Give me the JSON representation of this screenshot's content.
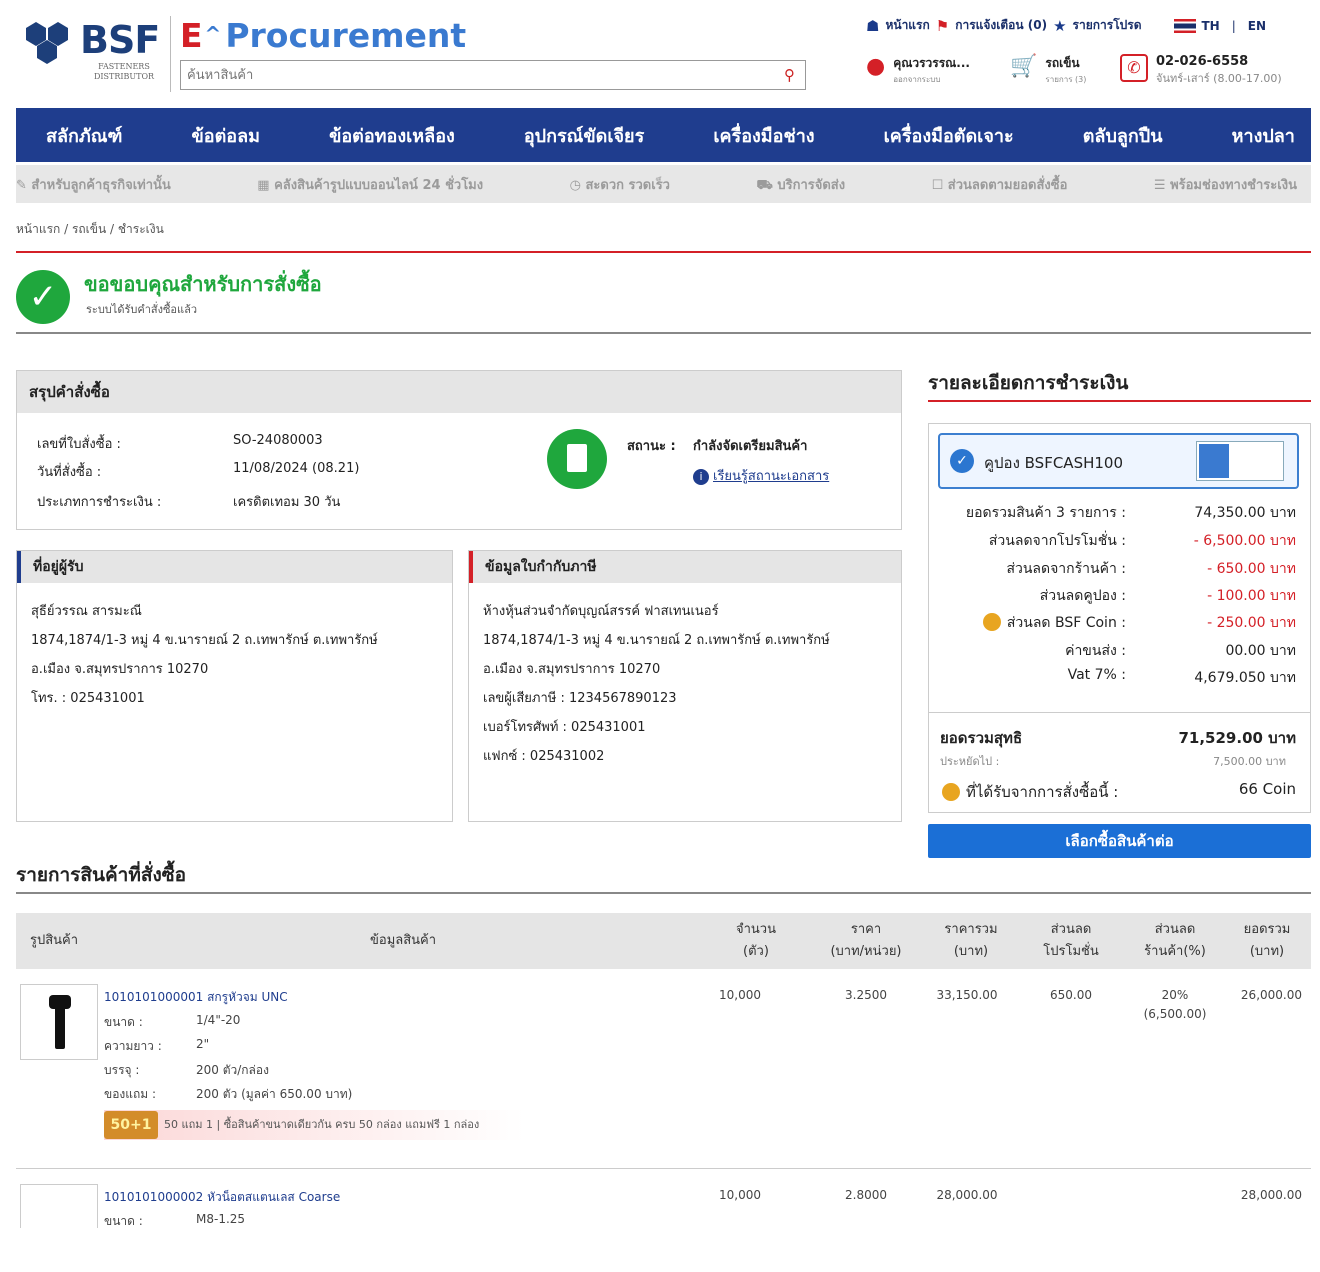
{
  "header": {
    "logo_text": "BSF",
    "logo_sub": "FASTENERS DISTRIBUTOR",
    "brand_e": "E",
    "brand_name": "Procurement",
    "search_placeholder": "ค้นหาสินค้า",
    "links": [
      "หน้าแรก",
      "การแจ้งเตือน (0)",
      "รายการโปรด"
    ],
    "lang_th": "TH",
    "lang_sep": "|",
    "lang_en": "EN",
    "user_name": "คุณวรวรรณ...",
    "user_sub": "ออกจากระบบ",
    "cart_label": "รถเข็น",
    "cart_sub": "รายการ (3)",
    "phone": "02-026-6558",
    "phone_hours": "จันทร์-เสาร์ (8.00-17.00)"
  },
  "nav": [
    "สลักภัณฑ์",
    "ข้อต่อลม",
    "ข้อต่อทองเหลือง",
    "อุปกรณ์ขัดเจียร",
    "เครื่องมือช่าง",
    "เครื่องมือตัดเจาะ",
    "ตลับลูกปืน",
    "หางปลา"
  ],
  "features": [
    "สำหรับลูกค้าธุรกิจเท่านั้น",
    "คลังสินค้ารูปแบบออนไลน์ 24 ชั่วโมง",
    "สะดวก รวดเร็ว",
    "บริการจัดส่ง",
    "ส่วนลดตามยอดสั่งซื้อ",
    "พร้อมช่องทางชำระเงิน"
  ],
  "breadcrumb": "หน้าแรก / รถเข็น / ชำระเงิน",
  "thanks": {
    "title": "ขอขอบคุณสำหรับการสั่งซื้อ",
    "sub": "ระบบได้รับคำสั่งซื้อแล้ว"
  },
  "summary": {
    "title": "สรุปคำสั่งซื้อ",
    "order_no_label": "เลขที่ใบสั่งซื้อ :",
    "order_no": "SO-24080003",
    "date_label": "วันที่สั่งซื้อ :",
    "date": "11/08/2024 (08.21)",
    "pay_type_label": "ประเภทการชำระเงิน :",
    "pay_type": "เครดิตเทอม 30 วัน",
    "status_label": "สถานะ :",
    "status": "กำลังจัดเตรียมสินค้า",
    "status_link": "เรียนรู้สถานะเอกสาร"
  },
  "recipient": {
    "title": "ที่อยู่ผู้รับ",
    "lines": [
      "สุธีย์วรรณ สารมะณี",
      "1874,1874/1-3 หมู่ 4 ข.นารายณ์ 2 ถ.เทพารักษ์ ต.เทพารักษ์",
      "อ.เมือง จ.สมุทรปราการ 10270",
      "โทร. : 025431001"
    ]
  },
  "tax": {
    "title": "ข้อมูลใบกำกับภาษี",
    "lines": [
      "ห้างหุ้นส่วนจำกัดบุญณ์สรรค์ ฟาสเทนเนอร์",
      "1874,1874/1-3 หมู่ 4 ข.นารายณ์ 2 ถ.เทพารักษ์ ต.เทพารักษ์",
      "อ.เมือง จ.สมุทรปราการ 10270",
      "เลขผู้เสียภาษี : 1234567890123",
      "เบอร์โทรศัพท์ : 025431001",
      "แฟกซ์ : 025431002"
    ]
  },
  "payment": {
    "title": "รายละเอียดการชำระเงิน",
    "coupon": "คูปอง BSFCASH100",
    "rows": [
      {
        "label": "ยอดรวมสินค้า 3 รายการ :",
        "value": "74,350.00 บาท",
        "neg": false,
        "coin": false
      },
      {
        "label": "ส่วนลดจากโปรโมชั่น :",
        "value": "- 6,500.00 บาท",
        "neg": true,
        "coin": false
      },
      {
        "label": "ส่วนลดจากร้านค้า :",
        "value": "- 650.00 บาท",
        "neg": true,
        "coin": false
      },
      {
        "label": "ส่วนลดคูปอง :",
        "value": "- 100.00 บาท",
        "neg": true,
        "coin": false
      },
      {
        "label": "ส่วนลด BSF Coin :",
        "value": "- 250.00 บาท",
        "neg": true,
        "coin": true
      },
      {
        "label": "ค่าขนส่ง :",
        "value": "00.00 บาท",
        "neg": false,
        "coin": false
      },
      {
        "label": "Vat 7% :",
        "value": "4,679.050 บาท",
        "neg": false,
        "coin": false
      }
    ],
    "net_label": "ยอดรวมสุทธิ",
    "net_value": "71,529.00 บาท",
    "saved_label": "ประหยัดไป :",
    "saved_value": "7,500.00 บาท",
    "coin_label": "ที่ได้รับจากการสั่งซื้อนี้ :",
    "coin_value": "66 Coin",
    "continue_button": "เลือกซื้อสินค้าต่อ"
  },
  "products": {
    "title": "รายการสินค้าที่สั่งซื้อ",
    "headers": {
      "image": "รูปสินค้า",
      "info": "ข้อมูลสินค้า",
      "qty": [
        "จำนวน",
        "(ตัว)"
      ],
      "price": [
        "ราคา",
        "(บาท/หน่วย)"
      ],
      "total": [
        "ราคารวม",
        "(บาท)"
      ],
      "promo": [
        "ส่วนลด",
        "โปรโมชั่น"
      ],
      "shop": [
        "ส่วนลด",
        "ร้านค้า(%)"
      ],
      "sum": [
        "ยอดรวม",
        "(บาท)"
      ]
    },
    "items": [
      {
        "name": "1010101000001 สกรูหัวจม UNC",
        "size_label": "ขนาด :",
        "size": "1/4\"-20",
        "length_label": "ความยาว :",
        "length": "2\"",
        "pack_label": "บรรจุ :",
        "pack": "200 ตัว/กล่อง",
        "gift_label": "ของแถม :",
        "gift": "200 ตัว (มูลค่า 650.00 บาท)",
        "qty": "10,000",
        "price": "3.2500",
        "total": "33,150.00",
        "promo": "650.00",
        "shop": "20%",
        "shop_sub": "(6,500.00)",
        "sum": "26,000.00",
        "promo_badge": "50+1",
        "promo_text": "50 แถม 1 | ซื้อสินค้าขนาดเดียวกัน ครบ 50 กล่อง แถมฟรี 1 กล่อง"
      },
      {
        "name": "1010101000002 หัวน็อตสแตนเลส Coarse",
        "size_label": "ขนาด :",
        "size": "M8-1.25",
        "qty": "10,000",
        "price": "2.8000",
        "total": "28,000.00",
        "sum": "28,000.00"
      }
    ]
  },
  "colors": {
    "brand_blue": "#1f3d8e",
    "accent_red": "#d42027",
    "success_green": "#1fa73d",
    "button_blue": "#1b6fd6"
  }
}
